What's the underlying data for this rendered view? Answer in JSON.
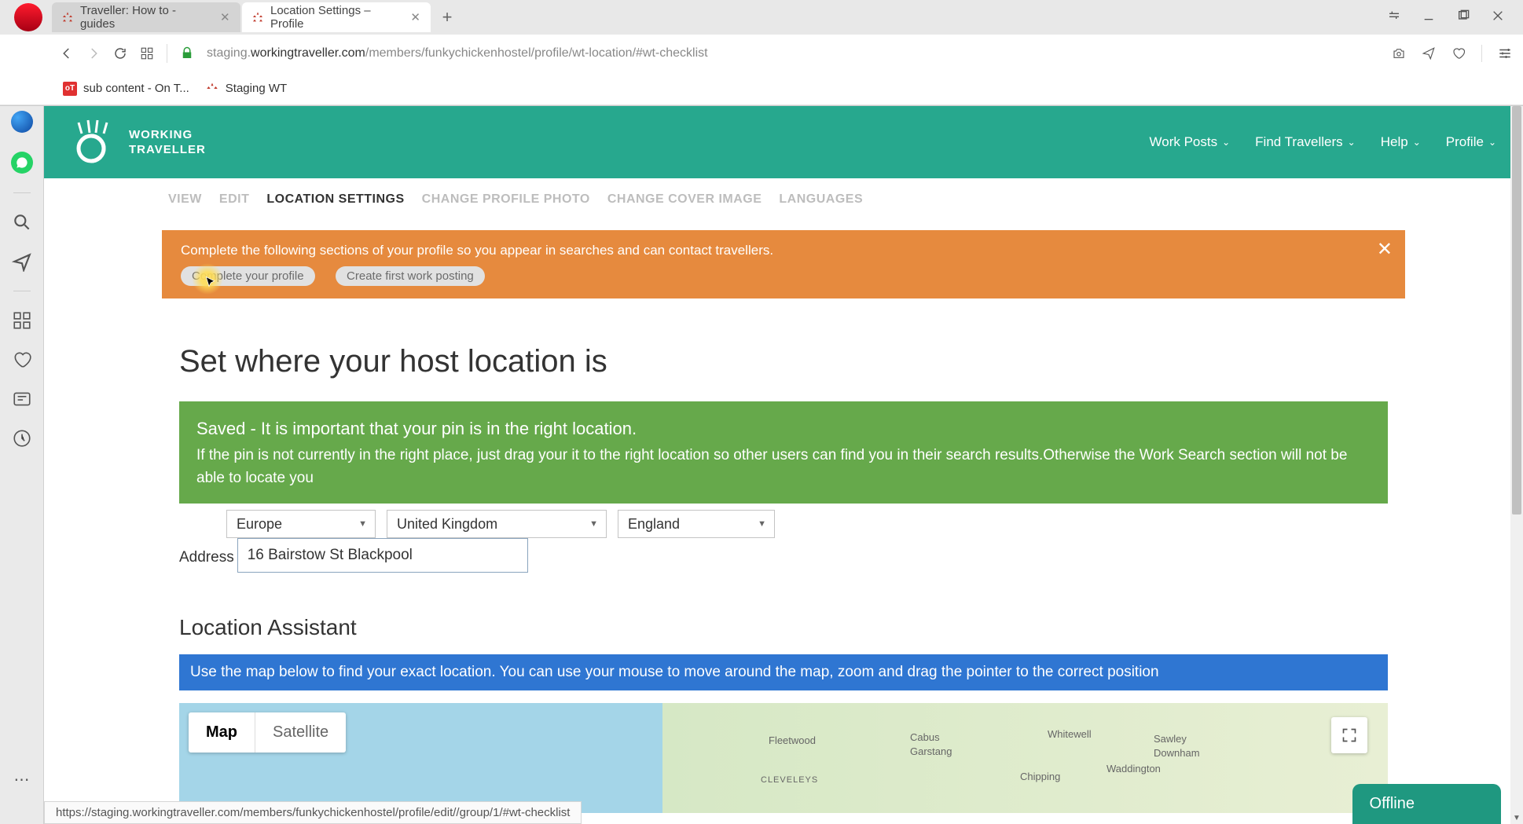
{
  "tabs": [
    {
      "title": "Traveller: How to - guides"
    },
    {
      "title": "Location Settings – Profile"
    }
  ],
  "url_prefix": "staging.",
  "url_domain": "workingtraveller.com",
  "url_path": "/members/funkychickenhostel/profile/wt-location/#wt-checklist",
  "bookmarks": [
    {
      "label": "sub content - On T..."
    },
    {
      "label": "Staging WT"
    }
  ],
  "logo_line1": "WORKING",
  "logo_line2": "TRAVELLER",
  "top_nav": {
    "work_posts": "Work Posts",
    "find_travellers": "Find Travellers",
    "help": "Help",
    "profile": "Profile"
  },
  "profile_tabs": {
    "view": "VIEW",
    "edit": "EDIT",
    "location": "LOCATION SETTINGS",
    "photo": "CHANGE PROFILE PHOTO",
    "cover": "CHANGE COVER IMAGE",
    "languages": "LANGUAGES"
  },
  "banner": {
    "message": "Complete the following sections of your profile so you appear in searches and can contact travellers.",
    "btn_profile": "Complete your profile",
    "btn_posting": "Create first work posting"
  },
  "heading": "Set where your host location is",
  "alert_green": {
    "title": "Saved - It is important that your pin is in the right location.",
    "body": "If the pin is not currently in the right place, just drag your it to the right location so other users can find you in their search results.Otherwise the Work Search section will not be able to locate you"
  },
  "selects": {
    "continent": "Europe",
    "country": "United Kingdom",
    "region": "England"
  },
  "address_label": "Address",
  "address_value": "16 Bairstow St Blackpool",
  "assistant_heading": "Location Assistant",
  "alert_blue": "Use the map below to find your exact location. You can use your mouse to move around the map, zoom and drag the pointer to the correct position",
  "map": {
    "btn_map": "Map",
    "btn_sat": "Satellite",
    "labels": {
      "fleetwood": "Fleetwood",
      "cleveleys": "CLEVELEYS",
      "cabus": "Cabus",
      "garstang": "Garstang",
      "whitewell": "Whitewell",
      "chipping": "Chipping",
      "waddington": "Waddington",
      "sawley": "Sawley",
      "downham": "Downham"
    }
  },
  "offline": "Offline",
  "status_url": "https://staging.workingtraveller.com/members/funkychickenhostel/profile/edit//group/1/#wt-checklist"
}
